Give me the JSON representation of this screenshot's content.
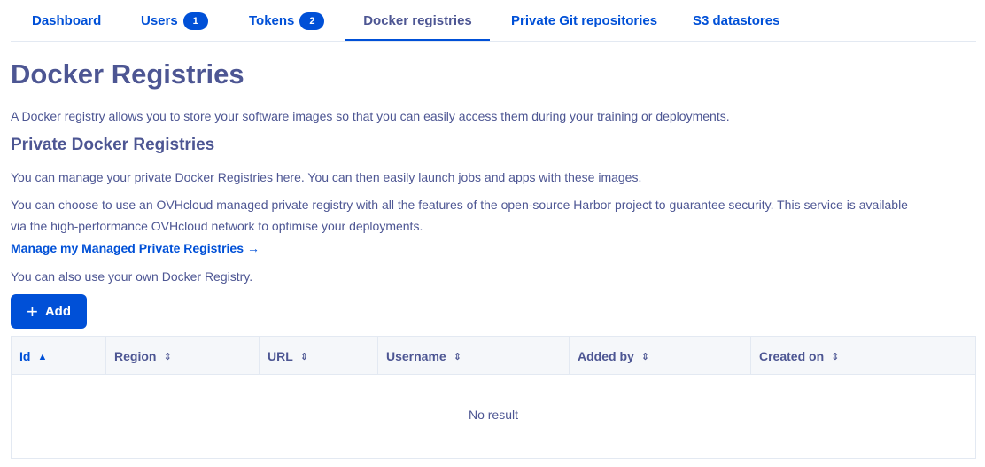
{
  "tabs": [
    {
      "label": "Dashboard",
      "badge": null
    },
    {
      "label": "Users",
      "badge": "1"
    },
    {
      "label": "Tokens",
      "badge": "2"
    },
    {
      "label": "Docker registries",
      "badge": null
    },
    {
      "label": "Private Git repositories",
      "badge": null
    },
    {
      "label": "S3 datastores",
      "badge": null
    }
  ],
  "active_tab": "Docker registries",
  "page": {
    "title": "Docker Registries",
    "intro": "A Docker registry allows you to store your software images so that you can easily access them during your training or deployments.",
    "section_title": "Private Docker Registries",
    "manage_text": "You can manage your private Docker Registries here. You can then easily launch jobs and apps with these images.",
    "managed_text_line1": "You can choose to use an OVHcloud managed private registry with all the features of the open-source Harbor project to guarantee security. This service is available",
    "managed_text_line2": "via the high-performance OVHcloud network to optimise your deployments.",
    "managed_link": "Manage my Managed Private Registries",
    "own_registry_text": "You can also use your own Docker Registry.",
    "add_button": "Add"
  },
  "table": {
    "columns": [
      {
        "label": "Id",
        "sort": "ascending"
      },
      {
        "label": "Region",
        "sort": "none"
      },
      {
        "label": "URL",
        "sort": "none"
      },
      {
        "label": "Username",
        "sort": "none"
      },
      {
        "label": "Added by",
        "sort": "none"
      },
      {
        "label": "Created on",
        "sort": "none"
      }
    ],
    "empty_text": "No result"
  },
  "icons": {
    "sort_ascending": "chevron-up-icon",
    "sort_none": "chevron-up-down-icon",
    "link_arrow": "arrow-right-icon",
    "add": "plus-icon"
  },
  "colors": {
    "primary": "#0050d7",
    "heading": "#4d5693",
    "border": "#e3e9f2",
    "table_header_bg": "#f5f7fa"
  }
}
